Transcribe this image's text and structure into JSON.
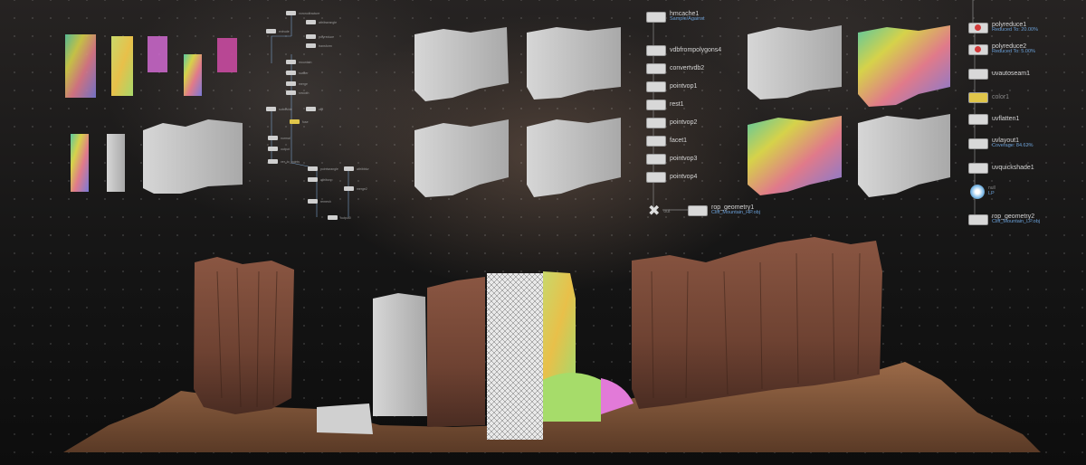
{
  "right_network": {
    "nodes": [
      {
        "name": "polyreduce1",
        "note": "Reduced To: 20.00%",
        "kind": "red"
      },
      {
        "name": "polyreduce2",
        "note": "Reduced To: 5.00%",
        "kind": "red"
      },
      {
        "name": "uvautoseam1",
        "note": "",
        "kind": "plain"
      },
      {
        "name": "color1",
        "note": "",
        "kind": "yellow"
      },
      {
        "name": "uvflatten1",
        "note": "",
        "kind": "plain"
      },
      {
        "name": "uvlayout1",
        "note": "Coverage: 84.62%",
        "kind": "plain"
      },
      {
        "name": "uvquickshade1",
        "note": "",
        "kind": "plain"
      },
      {
        "name": "null",
        "note": "LP",
        "kind": "icon"
      },
      {
        "name": "rop_geometry2",
        "note": "Cliff_Mountain_LP.obj",
        "kind": "plain"
      }
    ]
  },
  "middle_network": {
    "nodes": [
      {
        "name": "hmcache1",
        "note": "Sample/Against",
        "kind": "plain"
      },
      {
        "name": "vdbfrompolygons4",
        "note": "",
        "kind": "plain"
      },
      {
        "name": "convertvdb2",
        "note": "",
        "kind": "plain"
      },
      {
        "name": "pointvop1",
        "note": "",
        "kind": "plain"
      },
      {
        "name": "rest1",
        "note": "",
        "kind": "plain"
      },
      {
        "name": "pointvop2",
        "note": "",
        "kind": "plain"
      },
      {
        "name": "facet1",
        "note": "",
        "kind": "plain"
      },
      {
        "name": "pointvop3",
        "note": "",
        "kind": "plain"
      },
      {
        "name": "pointvop4",
        "note": "",
        "kind": "plain"
      }
    ],
    "output": {
      "name": "rop_geometry1",
      "note": "Cliff_Mountain_HP.obj"
    },
    "merge_label": "out"
  },
  "left_network": {
    "labels": [
      "voronoifracture",
      "attribwrangle",
      "extrude",
      "polyreduce",
      "transform",
      "mountain",
      "scatter",
      "merge",
      "smooth",
      "subdivide",
      "clip",
      "fuse",
      "normal",
      "output",
      "ver_to_points",
      "pointwrangle",
      "attribblur",
      "attribvop",
      "merge2",
      "remesh",
      "output0"
    ]
  },
  "colors": {
    "rock": "#7a4a36",
    "sand": "#8a5a3c",
    "clay_gray": "#bdbdbd",
    "uv_green": "#9fd86a",
    "uv_pink": "#e17ad8",
    "link_blue": "#6aa0d8",
    "node_red": "#d23b3b",
    "node_yellow": "#e0c64a"
  }
}
